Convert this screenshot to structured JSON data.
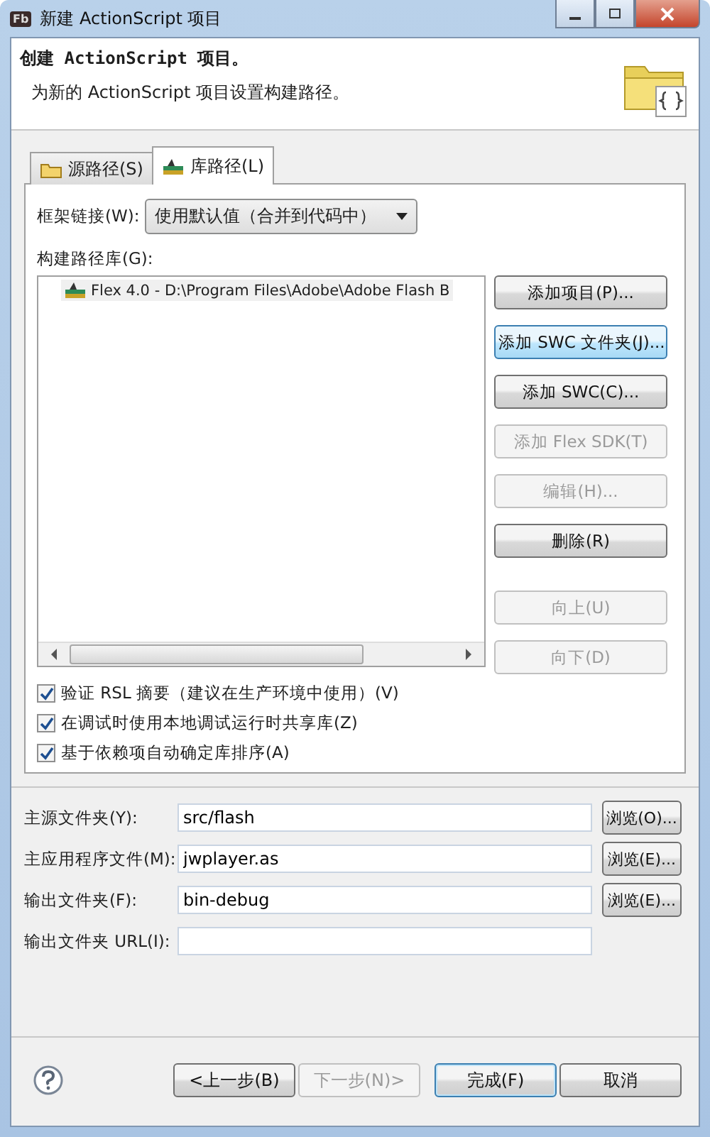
{
  "window": {
    "title": "新建 ActionScript 项目",
    "app_badge": "Fb"
  },
  "header": {
    "title": "创建 ActionScript 项目。",
    "description": "为新的 ActionScript 项目设置构建路径。"
  },
  "tabs": [
    {
      "label": "源路径(S)",
      "selected": false,
      "kind": "folder"
    },
    {
      "label": "库路径(L)",
      "selected": true,
      "kind": "library"
    }
  ],
  "framework_linkage": {
    "label": "框架链接(W):",
    "value": "使用默认值（合并到代码中）"
  },
  "library": {
    "label": "构建路径库(G):",
    "items": [
      {
        "label": "Flex 4.0 - D:\\Program Files\\Adobe\\Adobe Flash B"
      }
    ],
    "buttons": [
      {
        "label": "添加项目(P)...",
        "disabled": false,
        "hovered": false
      },
      {
        "label": "添加 SWC 文件夹(J)...",
        "disabled": false,
        "hovered": true
      },
      {
        "label": "添加 SWC(C)...",
        "disabled": false,
        "hovered": false
      },
      {
        "label": "添加 Flex SDK(T)",
        "disabled": true,
        "hovered": false
      },
      {
        "label": "编辑(H)...",
        "disabled": true,
        "hovered": false
      },
      {
        "label": "删除(R)",
        "disabled": false,
        "hovered": false
      }
    ],
    "order_buttons": [
      {
        "label": "向上(U)",
        "disabled": true
      },
      {
        "label": "向下(D)",
        "disabled": true
      }
    ]
  },
  "checkboxes": [
    {
      "label": "验证 RSL 摘要（建议在生产环境中使用）(V)",
      "checked": true
    },
    {
      "label": "在调试时使用本地调试运行时共享库(Z)",
      "checked": true
    },
    {
      "label": "基于依赖项自动确定库排序(A)",
      "checked": true
    }
  ],
  "fields": [
    {
      "label": "主源文件夹(Y):",
      "value": "src/flash",
      "button": "浏览(O)..."
    },
    {
      "label": "主应用程序文件(M):",
      "value": "jwplayer.as",
      "button": "浏览(E)..."
    },
    {
      "label": "输出文件夹(F):",
      "value": "bin-debug",
      "button": "浏览(E)..."
    },
    {
      "label": "输出文件夹 URL(I):"
    }
  ],
  "footer_buttons": [
    {
      "label": "<上一步(B)",
      "disabled": false,
      "default": false
    },
    {
      "label": "下一步(N)>",
      "disabled": true,
      "default": false
    },
    {
      "label": "完成(F)",
      "disabled": false,
      "default": true
    },
    {
      "label": "取消",
      "disabled": false,
      "default": false
    }
  ]
}
